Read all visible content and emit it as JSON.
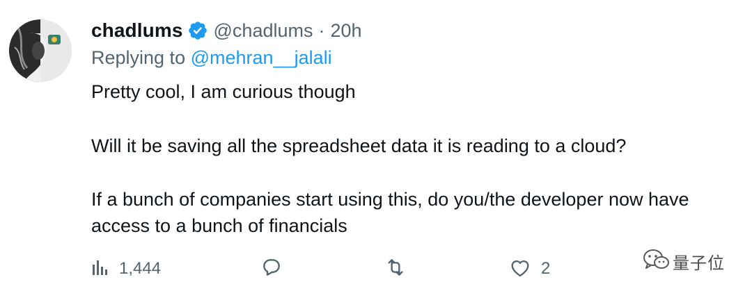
{
  "tweet": {
    "author": {
      "display_name": "chadlums",
      "handle": "@chadlums",
      "separator": "·",
      "time": "20h",
      "verified": true,
      "avatar_icon": "profile-avatar"
    },
    "reply_to": {
      "prefix": "Replying to",
      "mention": "@mehran__jalali"
    },
    "text": {
      "line1": "Pretty cool, I am curious though",
      "line2": "Will it be saving all the spreadsheet data it is reading to a cloud?",
      "line3a": "If a bunch of companies start using this, do you/the developer now have",
      "line3b": "access to a bunch of financials"
    },
    "actions": {
      "views": {
        "icon": "analytics-icon",
        "count": "1,444"
      },
      "reply": {
        "icon": "reply-icon"
      },
      "retweet": {
        "icon": "retweet-icon"
      },
      "like": {
        "icon": "heart-icon",
        "count": "2"
      }
    }
  },
  "watermark": {
    "icon": "wechat-icon",
    "text": "量子位"
  },
  "colors": {
    "text_primary": "#0f1419",
    "text_secondary": "#536471",
    "link": "#1d9bf0",
    "verified_badge": "#1d9bf0"
  }
}
